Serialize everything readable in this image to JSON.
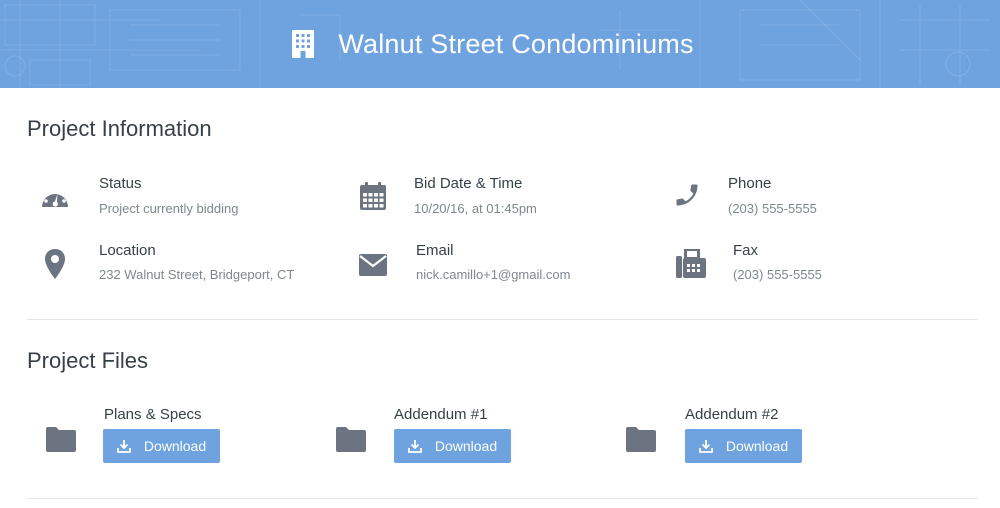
{
  "header": {
    "title": "Walnut Street Condominiums",
    "icon": "building-icon",
    "background_color": "#6fa3e0"
  },
  "project_information": {
    "heading": "Project Information",
    "items": [
      {
        "icon": "dashboard-gauge-icon",
        "label": "Status",
        "value": "Project currently bidding"
      },
      {
        "icon": "calendar-icon",
        "label": "Bid Date & Time",
        "value": "10/20/16, at 01:45pm"
      },
      {
        "icon": "phone-icon",
        "label": "Phone",
        "value": "(203) 555-5555"
      },
      {
        "icon": "map-pin-icon",
        "label": "Location",
        "value": "232 Walnut Street, Bridgeport, CT"
      },
      {
        "icon": "envelope-icon",
        "label": "Email",
        "value": "nick.camillo+1@gmail.com"
      },
      {
        "icon": "fax-icon",
        "label": "Fax",
        "value": "(203) 555-5555"
      }
    ]
  },
  "project_files": {
    "heading": "Project Files",
    "files": [
      {
        "icon": "folder-icon",
        "name": "Plans & Specs",
        "button_label": "Download"
      },
      {
        "icon": "folder-icon",
        "name": "Addendum #1",
        "button_label": "Download"
      },
      {
        "icon": "folder-icon",
        "name": "Addendum #2",
        "button_label": "Download"
      }
    ]
  },
  "colors": {
    "accent": "#6fa3e0",
    "icon_gray": "#6b7480",
    "text_dark": "#37404a",
    "text_muted": "#7e8791"
  }
}
